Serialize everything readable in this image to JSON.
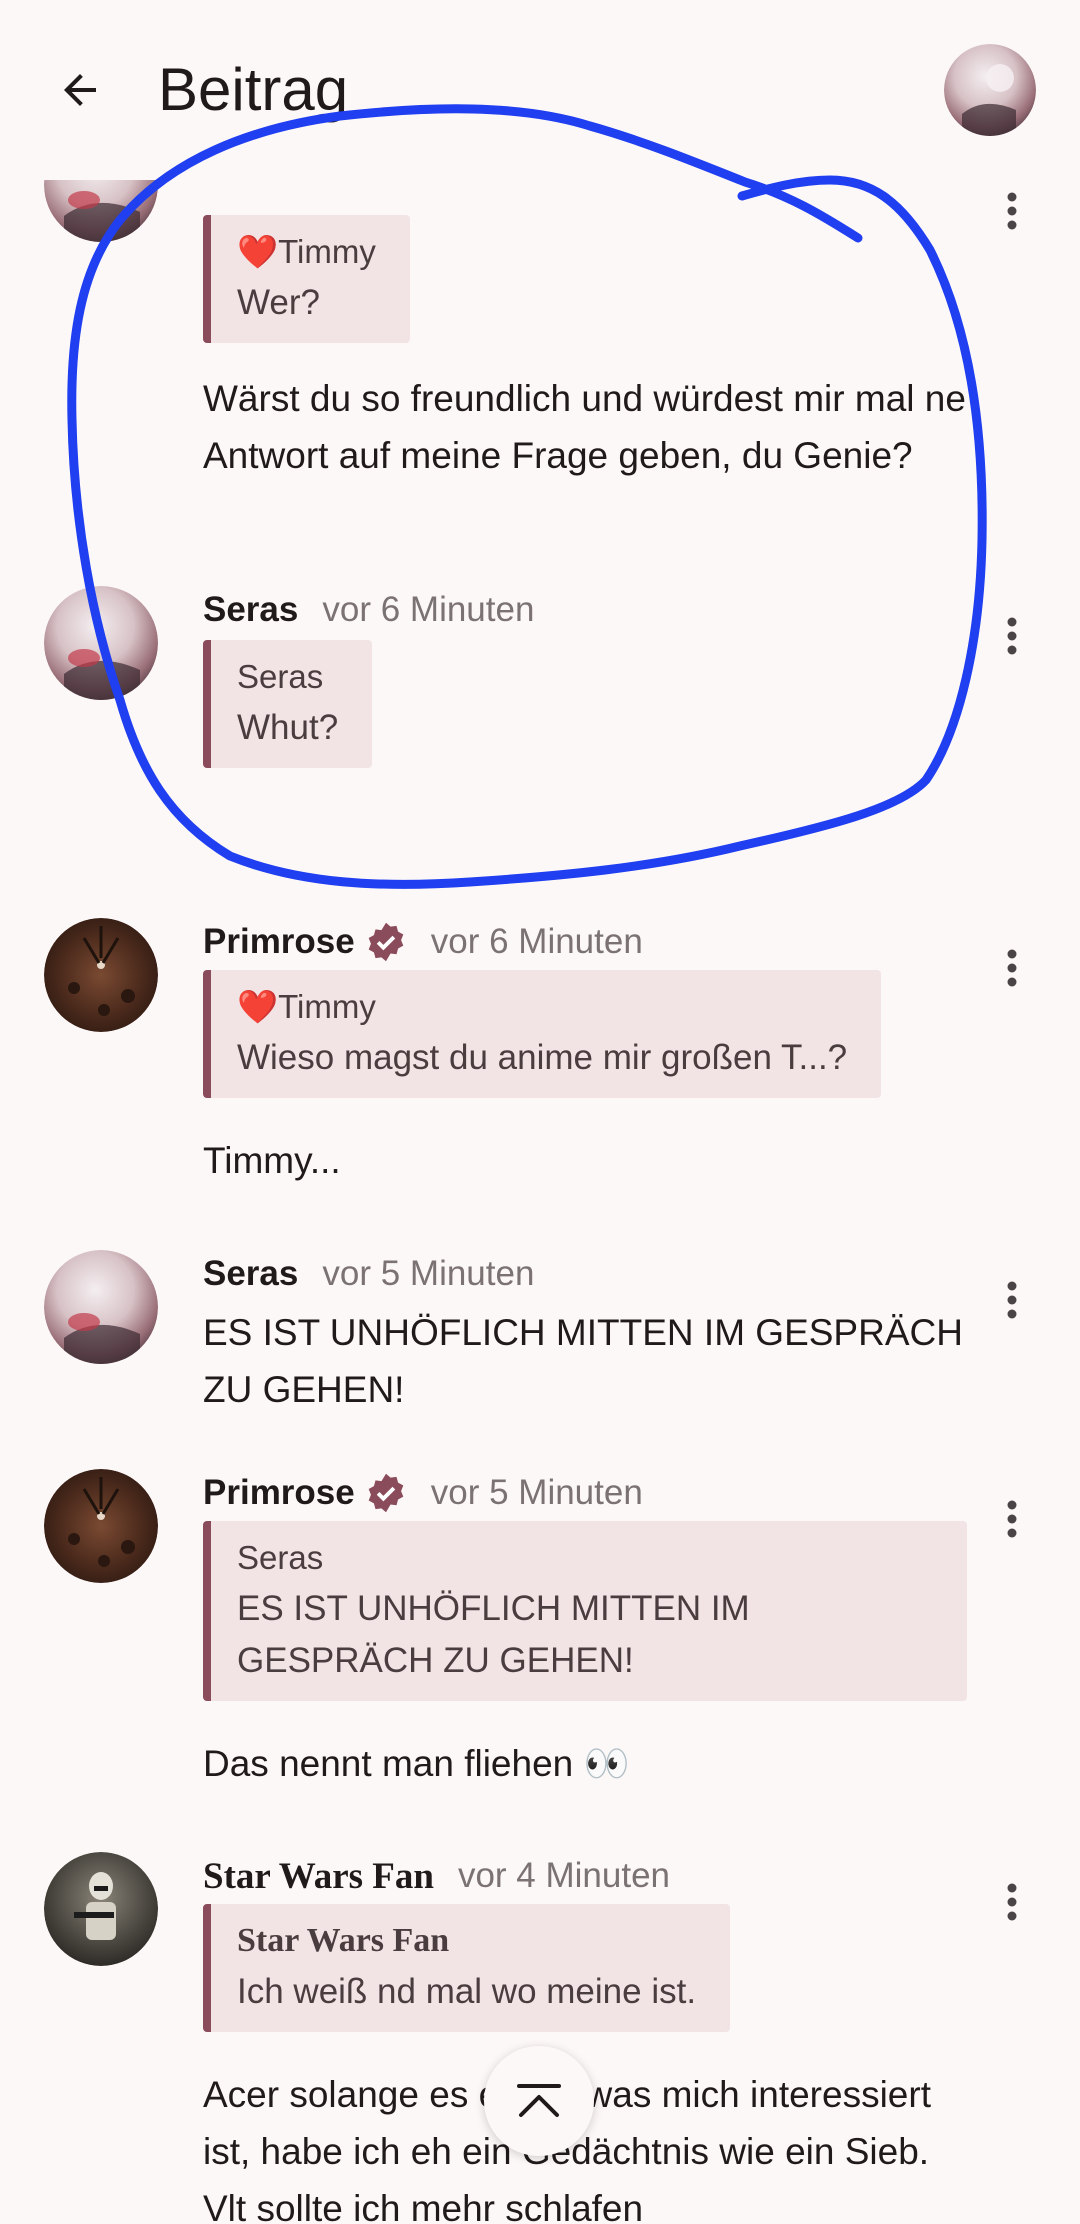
{
  "header": {
    "title": "Beitrag"
  },
  "posts": [
    {
      "quote": {
        "author": "❤️Timmy",
        "text": "Wer?"
      },
      "body": "Wärst du so freundlich und würdest mir mal ne Antwort auf meine Frage geben, du Genie?"
    },
    {
      "name": "Seras",
      "time": "vor 6 Minuten",
      "quote": {
        "author": "Seras",
        "text": "Whut?"
      },
      "body": "."
    },
    {
      "name": "Primrose",
      "verified": true,
      "time": "vor 6 Minuten",
      "quote": {
        "author": "❤️Timmy",
        "text": "Wieso magst du anime mir großen T...?"
      },
      "body": "Timmy..."
    },
    {
      "name": "Seras",
      "time": "vor 5 Minuten",
      "body": "ES IST UNHÖFLICH MITTEN IM GESPRÄCH ZU GEHEN!"
    },
    {
      "name": "Primrose",
      "verified": true,
      "time": "vor 5 Minuten",
      "quote": {
        "author": "Seras",
        "text": "ES IST UNHÖFLICH MITTEN IM GESPRÄCH ZU GEHEN!"
      },
      "body": "Das nennt man fliehen 👀"
    },
    {
      "name": "Star Wars Fan",
      "time": "vor 4 Minuten",
      "quote": {
        "author": "Star Wars Fan",
        "text": "Ich weiß nd mal wo meine ist."
      },
      "body": "Acer solange es etwas was mich interessiert ist, habe ich eh ein Gedächtnis wie ein Sieb. Vlt sollte ich mehr schlafen"
    }
  ],
  "icons": {
    "back": "arrow-left-icon",
    "more": "more-vertical-icon",
    "verified": "verified-badge-icon",
    "scroll_top": "scroll-to-top-icon"
  },
  "colors": {
    "background": "#fdf8f8",
    "quote_bg": "#f2e4e4",
    "quote_bar": "#8a4b5a",
    "verified": "#8a4b5a",
    "annotation": "#1f3ff0"
  }
}
